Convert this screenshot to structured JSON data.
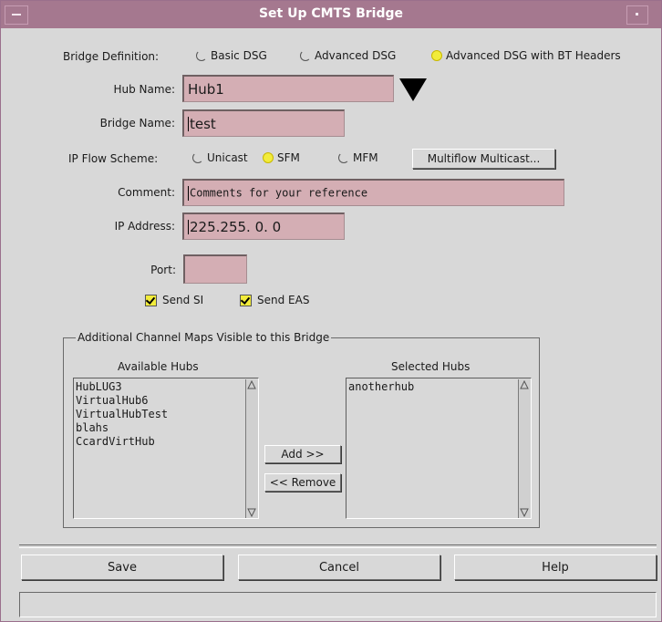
{
  "window": {
    "title": "Set Up CMTS Bridge"
  },
  "bridge_definition": {
    "label": "Bridge Definition:",
    "options": [
      {
        "label": "Basic DSG",
        "selected": false
      },
      {
        "label": "Advanced DSG",
        "selected": false
      },
      {
        "label": "Advanced DSG with BT Headers",
        "selected": true
      }
    ]
  },
  "hub_name": {
    "label": "Hub Name:",
    "value": "Hub1"
  },
  "bridge_name": {
    "label": "Bridge Name:",
    "value": "test"
  },
  "ip_flow_scheme": {
    "label": "IP Flow Scheme:",
    "options": [
      {
        "label": "Unicast",
        "selected": false
      },
      {
        "label": "SFM",
        "selected": true
      },
      {
        "label": "MFM",
        "selected": false
      }
    ],
    "multiflow_button": "Multiflow Multicast..."
  },
  "comment": {
    "label": "Comment:",
    "value": "Comments for your reference"
  },
  "ip_address": {
    "label": "IP Address:",
    "value": "225.255. 0. 0"
  },
  "port": {
    "label": "Port:",
    "value": ""
  },
  "checkboxes": [
    {
      "label": "Send SI",
      "checked": true
    },
    {
      "label": "Send  EAS",
      "checked": true
    }
  ],
  "channel_maps": {
    "legend": "Additional Channel Maps Visible to this Bridge",
    "available_label": "Available Hubs",
    "available": [
      "HubLUG3",
      "VirtualHub6",
      "VirtualHubTest",
      "blahs",
      "CcardVirtHub"
    ],
    "selected_label": "Selected Hubs",
    "selected": [
      "anotherhub"
    ],
    "add_button": "Add >>",
    "remove_button": "<< Remove"
  },
  "footer": {
    "save": "Save",
    "cancel": "Cancel",
    "help": "Help"
  },
  "colors": {
    "title_bar": "#a5788f",
    "field_bg": "#d4aeb4",
    "selected_radio": "#f2ec3b"
  }
}
